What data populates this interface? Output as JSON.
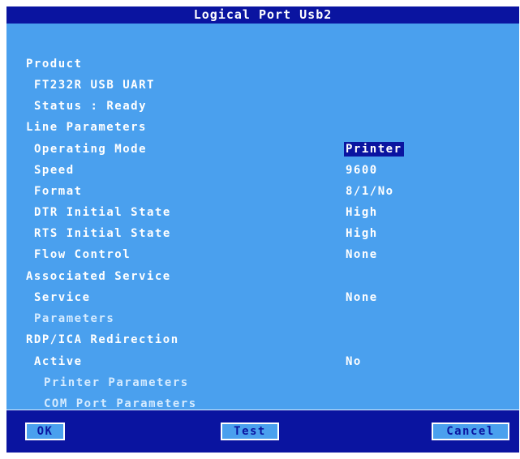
{
  "dialog": {
    "title": "Logical Port Usb2"
  },
  "product": {
    "heading": "Product",
    "name": "FT232R USB UART",
    "status": "Status : Ready"
  },
  "line_parameters": {
    "heading": "Line Parameters",
    "operating_mode": {
      "label": "Operating Mode",
      "value": "Printer"
    },
    "speed": {
      "label": "Speed",
      "value": "9600"
    },
    "format": {
      "label": "Format",
      "value": "8/1/No"
    },
    "dtr": {
      "label": "DTR Initial State",
      "value": "High"
    },
    "rts": {
      "label": "RTS Initial State",
      "value": "High"
    },
    "flow_control": {
      "label": "Flow Control",
      "value": "None"
    }
  },
  "associated_service": {
    "heading": "Associated Service",
    "service": {
      "label": "Service",
      "value": "None"
    },
    "parameters_label": "Parameters"
  },
  "redirection": {
    "heading": "RDP/ICA Redirection",
    "active": {
      "label": "Active",
      "value": "No"
    },
    "printer_parameters_label": "Printer Parameters",
    "com_port_parameters_label": "COM Port Parameters"
  },
  "buttons": {
    "ok": "OK",
    "test": "Test",
    "cancel": "Cancel"
  },
  "colors": {
    "title_bar": "#0a14a0",
    "panel": "#4aa0ee",
    "text": "#ffffff",
    "selection": "#0a14a0"
  }
}
